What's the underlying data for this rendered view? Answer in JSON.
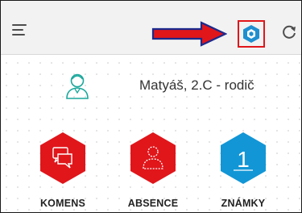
{
  "header": {
    "menu_icon": "hamburger-menu-icon",
    "arrow_color": "#e0161b",
    "logo_icon": "bakalari-logo-icon",
    "refresh_icon": "refresh-icon",
    "highlight_color": "#e0161b"
  },
  "user": {
    "avatar_icon": "parent-avatar-icon",
    "name": "Matyáš, 2.C - rodič"
  },
  "tiles": [
    {
      "label": "KOMENS",
      "icon": "chat-bubbles-icon",
      "color": "#e0161b"
    },
    {
      "label": "ABSENCE",
      "icon": "person-outline-icon",
      "color": "#e0161b"
    },
    {
      "label": "ZNÁMKY",
      "icon": "grade-one-icon",
      "color": "#1296d6",
      "glyph": "1"
    }
  ]
}
